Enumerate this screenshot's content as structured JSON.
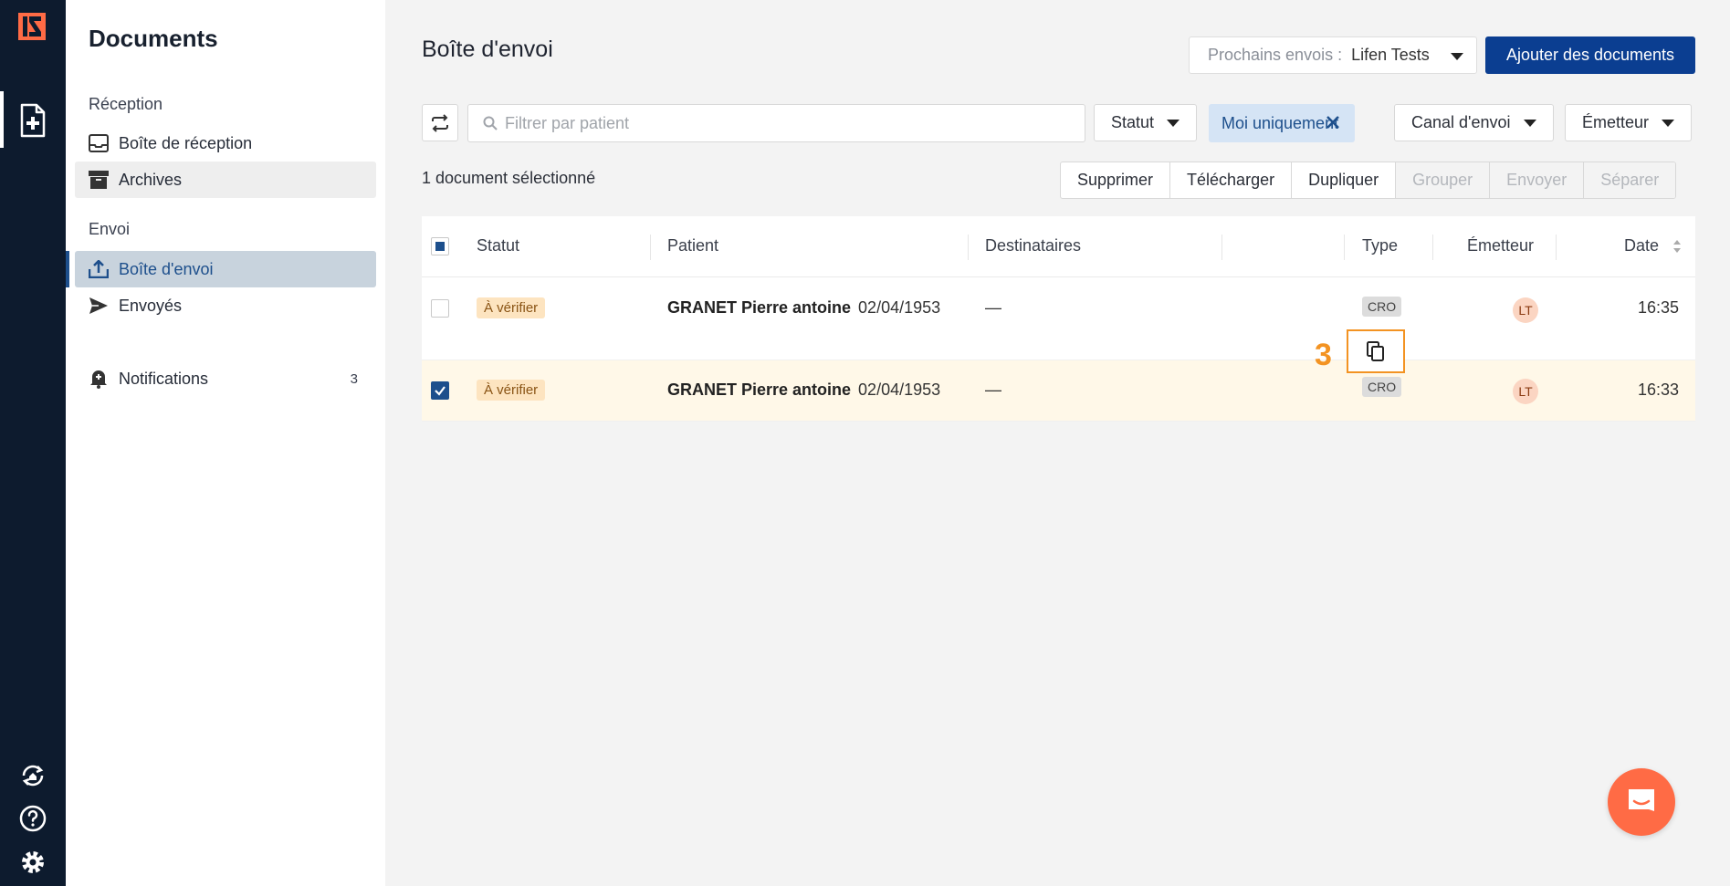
{
  "sidebar": {
    "title": "Documents",
    "section_reception": "Réception",
    "inbox_label": "Boîte de réception",
    "archives_label": "Archives",
    "section_envoi": "Envoi",
    "outbox_label": "Boîte d'envoi",
    "sent_label": "Envoyés",
    "notifications_label": "Notifications",
    "notifications_count": "3"
  },
  "header": {
    "title": "Boîte d'envoi",
    "next_sends_label": "Prochains envois :",
    "next_sends_value": "Lifen Tests",
    "add_button": "Ajouter des documents"
  },
  "filters": {
    "search_placeholder": "Filtrer par patient",
    "status_label": "Statut",
    "only_me_label": "Moi uniquement",
    "channel_label": "Canal d'envoi",
    "sender_label": "Émetteur"
  },
  "actions": {
    "selected_count": "1 document sélectionné",
    "delete": "Supprimer",
    "download": "Télécharger",
    "duplicate": "Dupliquer",
    "group": "Grouper",
    "send": "Envoyer",
    "split": "Séparer"
  },
  "table": {
    "columns": [
      "Statut",
      "Patient",
      "Destinataires",
      "Type",
      "Émetteur",
      "Date"
    ],
    "rows": [
      {
        "status": "À vérifier",
        "patient": "GRANET Pierre antoine",
        "dob": "02/04/1953",
        "recipients": "—",
        "type": "CRO",
        "sender": "LT",
        "time": "16:35",
        "checked": false
      },
      {
        "status": "À vérifier",
        "patient": "GRANET Pierre antoine",
        "dob": "02/04/1953",
        "recipients": "—",
        "type": "CRO",
        "sender": "LT",
        "time": "16:33",
        "checked": true
      }
    ]
  },
  "annotation": {
    "step_number": "3"
  },
  "colors": {
    "rail": "#0d1b2e",
    "primary": "#0b3e91",
    "accent": "#f39322",
    "chat": "#ff6b45"
  }
}
